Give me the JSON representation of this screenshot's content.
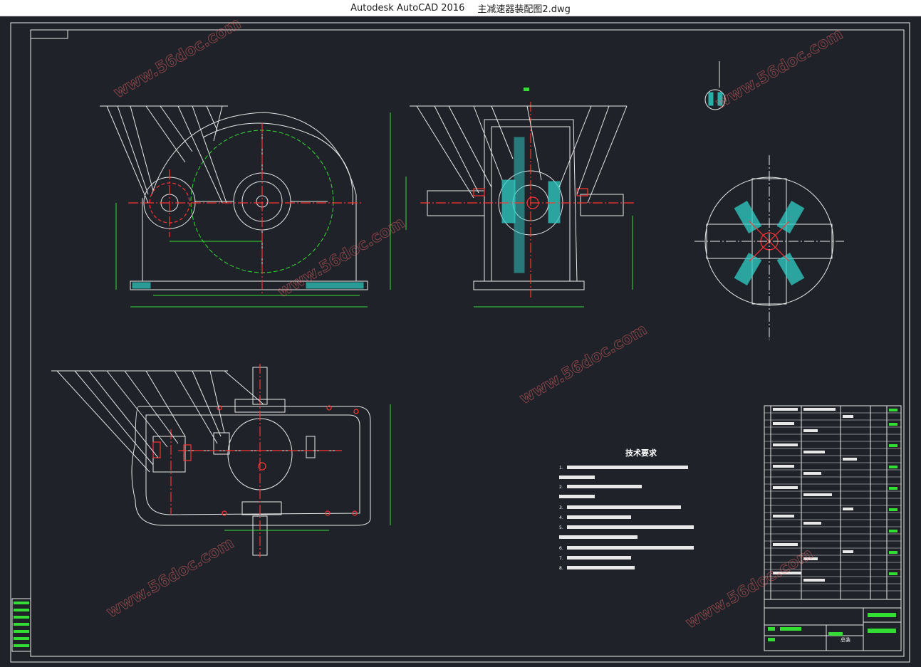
{
  "window": {
    "app_title": "Autodesk AutoCAD 2016",
    "file_name": "主减速器装配图2.dwg"
  },
  "drawing": {
    "tech_title": "技术要求",
    "tech_items": [
      "1.",
      "2.",
      "3.",
      "4.",
      "5.",
      "6.",
      "7.",
      "8."
    ],
    "watermark": "www.56doc.com",
    "title_block_cell": "总装"
  },
  "colors": {
    "background": "#1f2329",
    "lines": "#e8e8e8",
    "dimensions": "#33dd33",
    "centerlines": "#ff3333",
    "hatch": "#2fd0c8"
  }
}
